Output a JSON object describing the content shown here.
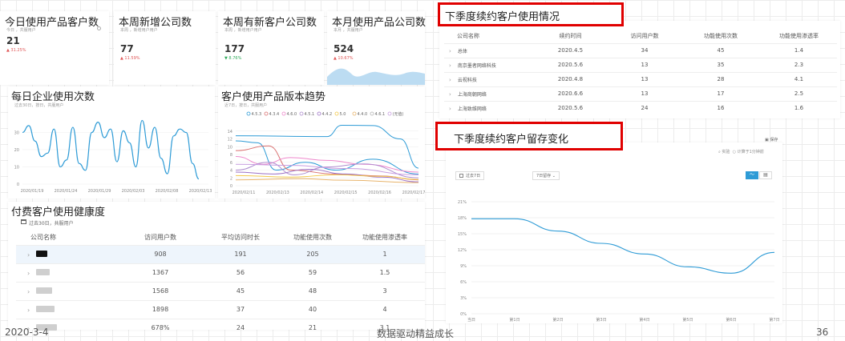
{
  "kpis": [
    {
      "title": "今日使用产品客户数",
      "sub": "今日 ，共服用户",
      "value": "21",
      "delta": "▲ 31.25%",
      "dir": "down"
    },
    {
      "title": "本周新增公司数",
      "sub": "本周 ，新增用户用户",
      "value": "77",
      "delta": "▲ 11.59%",
      "dir": "down"
    },
    {
      "title": "本周有新客户公司数",
      "sub": "本周 ，新增用户用户",
      "value": "177",
      "delta": "▼ 8.76%",
      "dir": "up"
    },
    {
      "title": "本月使用产品公司数",
      "sub": "本月 ，共服用户",
      "value": "524",
      "delta": "▲ 10.67%",
      "dir": "down"
    }
  ],
  "usage_chart": {
    "title": "每日企业使用次数",
    "sub": "过去30日，按日，共服用户",
    "chart_data": {
      "type": "line",
      "x": [
        "2020/01/19",
        "2020/01/24",
        "2020/01/29",
        "2020/02/03",
        "2020/02/08",
        "2020/02/13"
      ],
      "ylim": [
        0,
        40
      ],
      "yticks": [
        0,
        10,
        20,
        30
      ],
      "series": [
        {
          "values": [
            30,
            34,
            25,
            16,
            18,
            32,
            10,
            14,
            33,
            12,
            8,
            30,
            36,
            27,
            32,
            13,
            31,
            24,
            10,
            37,
            21,
            33,
            15,
            6,
            28,
            32,
            30,
            12,
            3
          ]
        }
      ]
    }
  },
  "version_chart": {
    "title": "客户使用产品版本趋势",
    "sub": "近7日，按日，共服用户",
    "chart_data": {
      "type": "line",
      "x": [
        "2020/02/11",
        "2020/02/13",
        "2020/02/14",
        "2020/02/15",
        "2020/02/16",
        "2020/02/17"
      ],
      "ylim": [
        0,
        16
      ],
      "yticks": [
        0,
        2,
        4,
        6,
        8,
        10,
        12,
        14
      ],
      "legend": [
        "4.5.3",
        "4.3.4",
        "4.6.0",
        "4.5.1",
        "4.4.2",
        "5.0",
        "4.4.0",
        "4.6.1",
        "(无值)"
      ],
      "colors": [
        "#2e9bd6",
        "#d97070",
        "#ee88cc",
        "#b08ed0",
        "#9e72c6",
        "#f2c94c",
        "#e8b46c",
        "#b3b3b3",
        "#c79ee0"
      ]
    }
  },
  "health": {
    "title": "付费客户使用健康度",
    "sub": "过去30日，共服用户",
    "headers": [
      "公司名称",
      "访问用户数",
      "平均访问时长",
      "功能使用次数",
      "功能使用渗透率"
    ],
    "rows": [
      {
        "cells": [
          "908",
          "191",
          "205",
          "1"
        ]
      },
      {
        "cells": [
          "1367",
          "56",
          "59",
          "1.5"
        ]
      },
      {
        "cells": [
          "1568",
          "45",
          "48",
          "3"
        ]
      },
      {
        "cells": [
          "1898",
          "37",
          "40",
          "4"
        ]
      },
      {
        "cells": [
          "678%",
          "24",
          "21",
          "3.1"
        ]
      }
    ]
  },
  "renewal": {
    "title": "下季度续约客户使用情况",
    "headers": [
      "公司名称",
      "续约时间",
      "访问用户数",
      "功能使用次数",
      "功能使用渗透率"
    ],
    "rows": [
      [
        "总体",
        "2020.4.5",
        "34",
        "45",
        "1.4"
      ],
      [
        "南京墨者网络科技",
        "2020.5.6",
        "13",
        "35",
        "2.3"
      ],
      [
        "云视科技",
        "2020.4.8",
        "13",
        "28",
        "4.1"
      ],
      [
        "上海商朝网络",
        "2020.6.6",
        "13",
        "17",
        "2.5"
      ],
      [
        "上海致维网络",
        "2020.5.6",
        "24",
        "16",
        "1.6"
      ]
    ]
  },
  "retention": {
    "title": "下季度续约客户留存变化",
    "save_label": "保存",
    "actions": [
      "实验",
      "计算于1分钟前"
    ],
    "date_range": "过去7日",
    "metric_select": "7日留存",
    "chart_data": {
      "type": "line",
      "x": [
        "当日",
        "第1日",
        "第2日",
        "第3日",
        "第4日",
        "第5日",
        "第6日",
        "第7日"
      ],
      "ylim": [
        0,
        21
      ],
      "yticks": [
        "0%",
        "3%",
        "6%",
        "9%",
        "12%",
        "15%",
        "18%",
        "21%"
      ],
      "series": [
        {
          "values": [
            17.8,
            17.8,
            15.5,
            13.2,
            11.2,
            8.8,
            7.6,
            11.5
          ]
        }
      ],
      "color": "#2e9bd6"
    }
  },
  "footer": {
    "date": "2020-3-4",
    "center": "数据驱动精益成长",
    "page": "36"
  }
}
